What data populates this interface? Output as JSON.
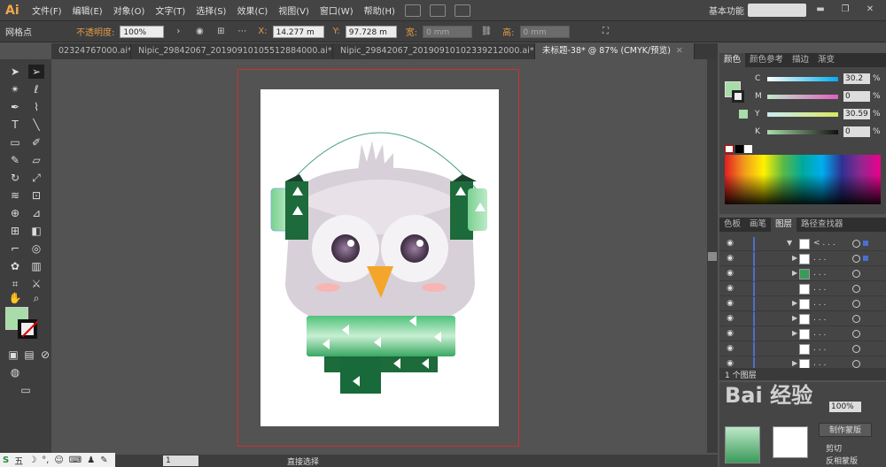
{
  "app": {
    "logo": "Ai"
  },
  "menu": [
    "文件(F)",
    "编辑(E)",
    "对象(O)",
    "文字(T)",
    "选择(S)",
    "效果(C)",
    "视图(V)",
    "窗口(W)",
    "帮助(H)"
  ],
  "workspace": "基本功能",
  "control": {
    "mode_label": "网格点",
    "opacity_label": "不透明度:",
    "opacity_value": "100%",
    "x_label": "X:",
    "x_value": "14.277 m",
    "y_label": "Y:",
    "y_value": "97.728 m",
    "w_label": "宽:",
    "w_value": "0 mm",
    "h_label": "高:",
    "h_value": "0 mm"
  },
  "tabs": [
    {
      "label": "02324767000.ai*",
      "active": false
    },
    {
      "label": "Nipic_29842067_20190910105512884000.ai*",
      "active": false
    },
    {
      "label": "Nipic_29842067_20190910102339212000.ai*",
      "active": false
    },
    {
      "label": "未标题-38* @ 87% (CMYK/预览)",
      "active": true
    }
  ],
  "color_panel": {
    "tabs": [
      "颜色",
      "颜色参考",
      "描边",
      "渐变"
    ],
    "channels": [
      {
        "label": "C",
        "value": "30.2"
      },
      {
        "label": "M",
        "value": "0"
      },
      {
        "label": "Y",
        "value": "30.59"
      },
      {
        "label": "K",
        "value": "0"
      }
    ],
    "pct": "%"
  },
  "layers_panel": {
    "tabs": [
      "色板",
      "画笔",
      "图层",
      "路径查找器"
    ],
    "rows": [
      "< . . .",
      ". . .",
      ". . .",
      ". . .",
      ". . .",
      ". . .",
      ". . .",
      ". . .",
      ". . ."
    ],
    "footer": "1 个图层"
  },
  "status": {
    "zoom": "1",
    "tool": "直接选择"
  },
  "bottom_panel": {
    "opacity": "100%",
    "make_mask": "制作蒙版",
    "clip": "剪切",
    "invert": "反相蒙版"
  },
  "ime": [
    "五",
    "☽",
    "°,",
    "☺",
    "⌨",
    "♟",
    "✎"
  ],
  "watermark": "Bai 经验",
  "colors": {
    "fill": "#a8dca8",
    "owl_body": "#d8d0d8",
    "owl_light": "#e8e2e8",
    "scarf_light": "#7bd090",
    "scarf_dark": "#186a3a",
    "beak": "#f4a62a",
    "cheek": "#f7b6b4"
  }
}
